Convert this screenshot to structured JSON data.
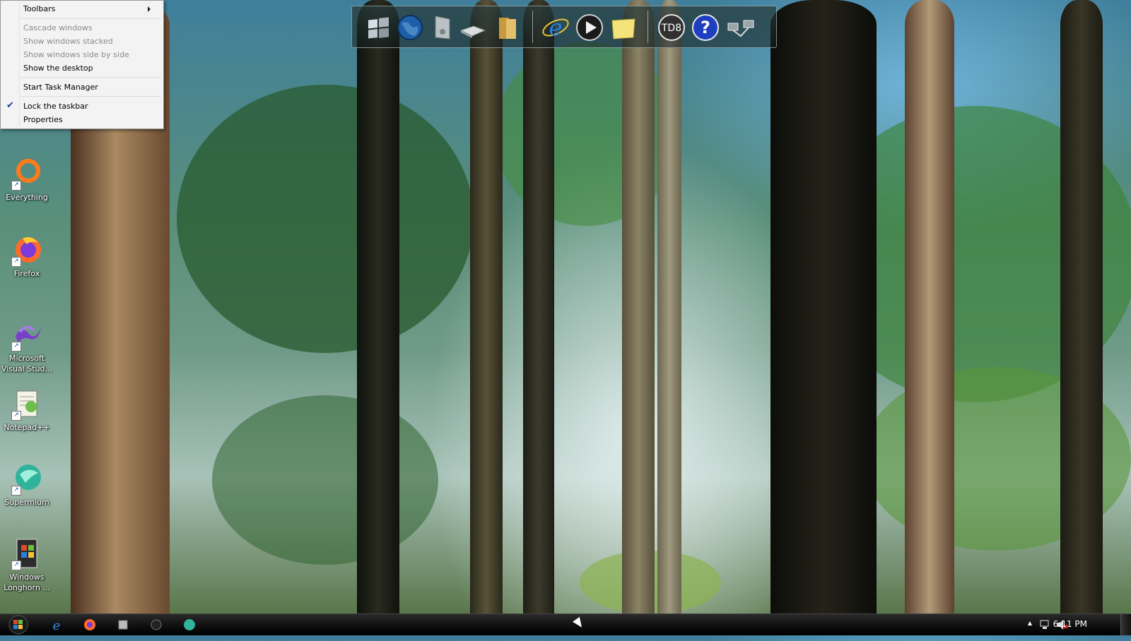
{
  "context_menu": {
    "items": [
      {
        "label": "Toolbars",
        "enabled": true,
        "submenu": true
      },
      {
        "label": "Cascade windows",
        "enabled": false
      },
      {
        "label": "Show windows stacked",
        "enabled": false
      },
      {
        "label": "Show windows side by side",
        "enabled": false
      },
      {
        "label": "Show the desktop",
        "enabled": true
      },
      {
        "label": "Start Task Manager",
        "enabled": true
      },
      {
        "label": "Lock the taskbar",
        "enabled": true,
        "checked": true
      },
      {
        "label": "Properties",
        "enabled": true
      }
    ],
    "check_glyph": "✔"
  },
  "dock": {
    "icons": [
      "windows-logo-icon",
      "globe-icon",
      "disk-icon",
      "drive-icon",
      "folder-icon",
      "internet-explorer-icon",
      "media-player-icon",
      "note-icon",
      "td8-icon",
      "help-icon",
      "network-icon"
    ],
    "td8_text": "TD8",
    "help_glyph": "?"
  },
  "desktop_icons": [
    {
      "label": "Everything",
      "icon": "everything-icon"
    },
    {
      "label": "Firefox",
      "icon": "firefox-icon"
    },
    {
      "label": "Microsoft Visual Stud...",
      "icon": "visual-studio-icon"
    },
    {
      "label": "Notepad++",
      "icon": "notepad-plus-plus-icon"
    },
    {
      "label": "Supermium",
      "icon": "supermium-icon"
    },
    {
      "label": "Windows Longhorn ...",
      "icon": "windows-longhorn-icon"
    }
  ],
  "shortcut_arrow": "↗",
  "taskbar": {
    "pinned": [
      "internet-explorer-icon",
      "firefox-icon",
      "explorer-icon",
      "media-icon",
      "supermium-icon"
    ],
    "ie_glyph": "e",
    "clock": "6:11 PM",
    "tray_icons": [
      "show-hidden-icons-chevron",
      "network-icon",
      "volume-muted-icon"
    ],
    "chevron_glyph": "▲"
  }
}
